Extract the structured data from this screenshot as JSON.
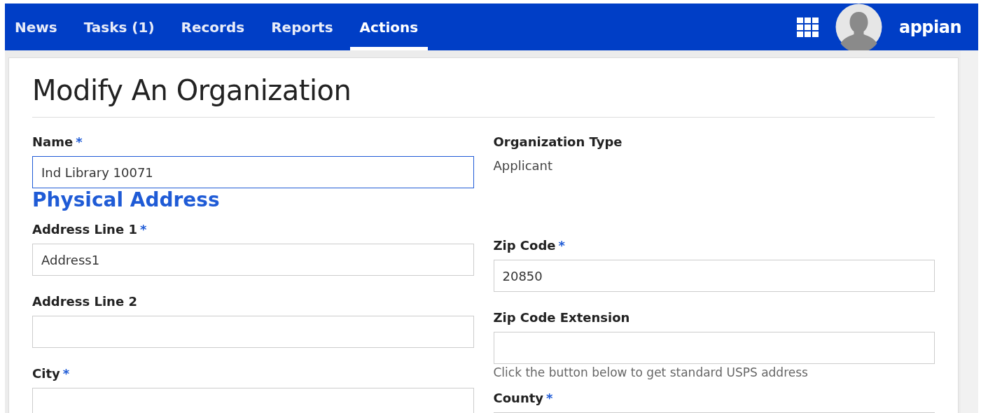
{
  "nav": {
    "tabs": [
      {
        "label": "News",
        "selected": false
      },
      {
        "label": "Tasks (1)",
        "selected": false
      },
      {
        "label": "Records",
        "selected": false
      },
      {
        "label": "Reports",
        "selected": false
      },
      {
        "label": "Actions",
        "selected": true
      }
    ],
    "logo": "appian"
  },
  "form": {
    "title": "Modify An Organization",
    "columns": [
      [
        {
          "kind": "input",
          "label": "Name",
          "required_mark": "*",
          "value": "Ind Library 10071",
          "focused": true
        },
        {
          "kind": "heading",
          "text": "Physical Address"
        },
        {
          "kind": "input",
          "label": "Address Line 1",
          "required_mark": "*",
          "value": "Address1",
          "focused": false
        },
        {
          "kind": "input",
          "label": "Address Line 2",
          "focused": false
        },
        {
          "kind": "input",
          "label": "City",
          "required_mark": "*",
          "focused": false
        }
      ],
      [
        {
          "kind": "readonly",
          "label": "Organization Type",
          "value": "Applicant"
        },
        {
          "kind": "input",
          "label": "Zip Code",
          "required_mark": "*",
          "value": "20850",
          "focused": false
        },
        {
          "kind": "input",
          "label": "Zip Code Extension",
          "focused": false
        },
        {
          "kind": "hint",
          "text": "Click the button below to get standard USPS address"
        },
        {
          "kind": "input",
          "label": "County",
          "required_mark": "*",
          "focused": false
        }
      ]
    ]
  }
}
